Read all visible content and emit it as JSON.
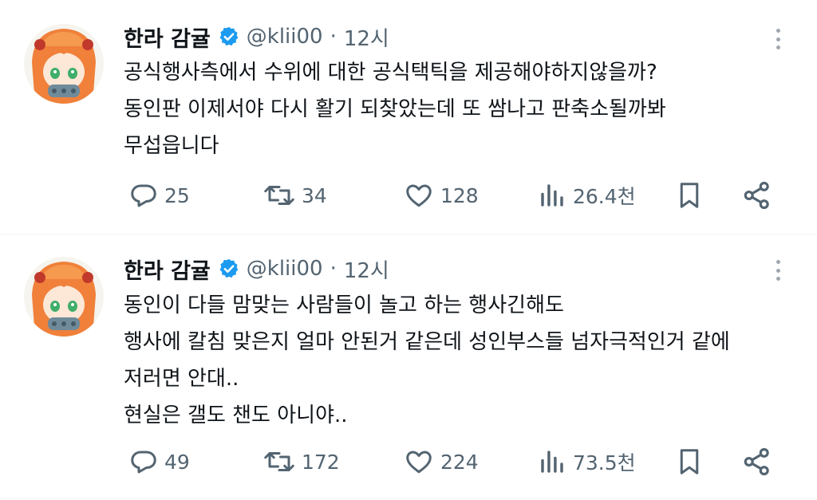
{
  "tweets": [
    {
      "author_name": "한라 감귤",
      "handle": "@klii00",
      "separator": "·",
      "time": "12시",
      "lines": [
        "공식행사측에서 수위에 대한 공식택틱을 제공해야하지않을까?",
        "동인판 이제서야 다시 활기 되찾았는데 또 쌈나고 판축소될까봐",
        "무섭읍니다"
      ],
      "replies": "25",
      "retweets": "34",
      "likes": "128",
      "views": "26.4천"
    },
    {
      "author_name": "한라 감귤",
      "handle": "@klii00",
      "separator": "·",
      "time": "12시",
      "lines": [
        "동인이 다들 맘맞는 사람들이 놀고 하는 행사긴해도",
        "행사에 칼침 맞은지 얼마 안된거 같은데 성인부스들 넘자극적인거 같에",
        "저러면 안대..",
        "현실은 갤도 챈도 아니야.."
      ],
      "replies": "49",
      "retweets": "172",
      "likes": "224",
      "views": "73.5천"
    }
  ],
  "icons": {
    "verified": "verified-badge-icon",
    "more": "more-options-icon",
    "reply": "reply-icon",
    "retweet": "retweet-icon",
    "like": "heart-icon",
    "views": "views-chart-icon",
    "bookmark": "bookmark-icon",
    "share": "share-icon"
  },
  "colors": {
    "verified_blue": "#1d9bf0",
    "secondary_text": "#536471",
    "divider": "#eff3f4"
  }
}
